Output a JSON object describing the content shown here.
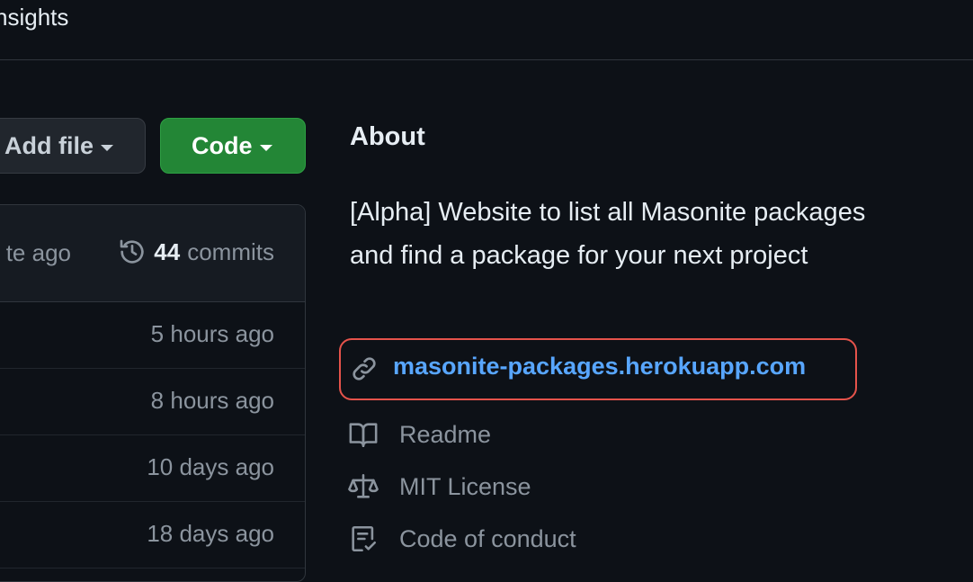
{
  "nav": {
    "tab_label": "nsights"
  },
  "toolbar": {
    "add_file_label": "Add file",
    "code_label": "Code"
  },
  "files": {
    "latest_time": "te ago",
    "commit_count": "44",
    "commits_label": "commits",
    "rows": [
      {
        "time": "5 hours ago"
      },
      {
        "time": "8 hours ago"
      },
      {
        "time": "10 days ago"
      },
      {
        "time": "18 days ago"
      }
    ]
  },
  "about": {
    "title": "About",
    "description": "[Alpha] Website to list all Masonite packages and find a package for your next project",
    "website": "masonite-packages.herokuapp.com",
    "links": [
      {
        "label": "Readme",
        "icon": "book-icon"
      },
      {
        "label": "MIT License",
        "icon": "law-icon"
      },
      {
        "label": "Code of conduct",
        "icon": "code-of-conduct-icon"
      }
    ]
  },
  "colors": {
    "background": "#0d1117",
    "accent_link": "#58a6ff",
    "code_button": "#238636",
    "highlight": "#e5534b"
  }
}
